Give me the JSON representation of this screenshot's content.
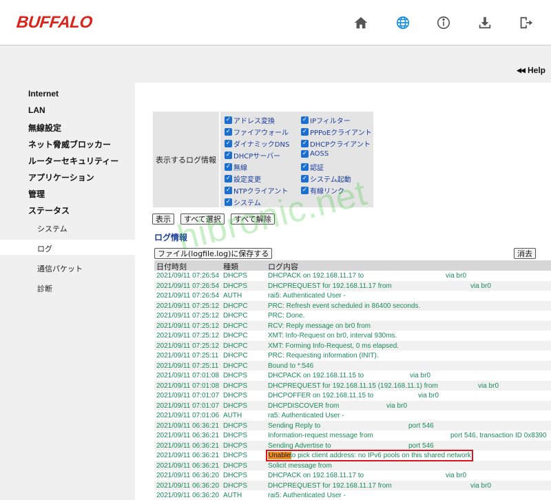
{
  "brand": {
    "logo": "BUFFALO",
    "color": "#d9241b"
  },
  "header_icons": [
    {
      "name": "home-icon"
    },
    {
      "name": "globe-icon",
      "active": true
    },
    {
      "name": "info-icon"
    },
    {
      "name": "download-icon"
    },
    {
      "name": "logout-icon"
    }
  ],
  "help": {
    "label": "Help"
  },
  "sidebar": {
    "main_items": [
      "Internet",
      "LAN",
      "無線設定",
      "ネット脅威ブロッカー",
      "ルーターセキュリティー",
      "アプリケーション",
      "管理",
      "ステータス"
    ],
    "sub_items": [
      "システム",
      "ログ",
      "通信パケット",
      "診断"
    ],
    "active": "ログ"
  },
  "filter": {
    "label": "表示するログ情報",
    "options_left": [
      "アドレス変換",
      "ファイアウォール",
      "ダイナミックDNS",
      "DHCPサーバー",
      "無線",
      "設定変更",
      "NTPクライアント",
      "システム"
    ],
    "options_right": [
      "IPフィルター",
      "PPPoEクライアント",
      "DHCPクライアント",
      "AOSS",
      "認証",
      "システム起動",
      "有線リンク"
    ]
  },
  "buttons": {
    "show": "表示",
    "select_all": "すべて選択",
    "clear_all": "すべて解除",
    "save_file": "ファイル(logfile.log)に保存する",
    "delete": "消去"
  },
  "log_section_title": "ログ情報",
  "log_columns": [
    "日付時刻",
    "種類",
    "ログ内容"
  ],
  "log_rows": [
    {
      "date": "2021/09/11 07:26:54",
      "type": "DHCPS",
      "msg": "DHCPACK on 192.168.11.17 to",
      "extra": "via br0"
    },
    {
      "date": "2021/09/11 07:26:54",
      "type": "DHCPS",
      "msg": "DHCPREQUEST for 192.168.11.17 from",
      "extra": "via br0"
    },
    {
      "date": "2021/09/11 07:26:54",
      "type": "AUTH",
      "msg": "rai5: Authenticated User -",
      "extra": ""
    },
    {
      "date": "2021/09/11 07:25:12",
      "type": "DHCPC",
      "msg": "PRC: Refresh event scheduled in 86400 seconds.",
      "extra": ""
    },
    {
      "date": "2021/09/11 07:25:12",
      "type": "DHCPC",
      "msg": "PRC: Done.",
      "extra": ""
    },
    {
      "date": "2021/09/11 07:25:12",
      "type": "DHCPC",
      "msg": "RCV: Reply message on br0 from",
      "extra": ""
    },
    {
      "date": "2021/09/11 07:25:12",
      "type": "DHCPC",
      "msg": "XMT: Info-Request on br0, interval 930ms.",
      "extra": ""
    },
    {
      "date": "2021/09/11 07:25:12",
      "type": "DHCPC",
      "msg": "XMT: Forming Info-Request, 0 ms elapsed.",
      "extra": ""
    },
    {
      "date": "2021/09/11 07:25:11",
      "type": "DHCPC",
      "msg": "PRC: Requesting information (INIT).",
      "extra": ""
    },
    {
      "date": "2021/09/11 07:25:11",
      "type": "DHCPC",
      "msg": "Bound to *:546",
      "extra": ""
    },
    {
      "date": "2021/09/11 07:01:08",
      "type": "DHCPS",
      "msg": "DHCPACK on 192.168.11.15 to",
      "extra": "via br0"
    },
    {
      "date": "2021/09/11 07:01:08",
      "type": "DHCPS",
      "msg": "DHCPREQUEST for 192.168.11.15 (192.168.11.1) from",
      "extra": "via br0"
    },
    {
      "date": "2021/09/11 07:01:07",
      "type": "DHCPS",
      "msg": "DHCPOFFER on 192.168.11.15 to",
      "extra": "via br0"
    },
    {
      "date": "2021/09/11 07:01:07",
      "type": "DHCPS",
      "msg": "DHCPDISCOVER from",
      "extra": "via br0"
    },
    {
      "date": "2021/09/11 07:01:06",
      "type": "AUTH",
      "msg": "ra5: Authenticated User -",
      "extra": ""
    },
    {
      "date": "2021/09/11 06:36:21",
      "type": "DHCPS",
      "msg": "Sending Reply to",
      "extra": "port 546"
    },
    {
      "date": "2021/09/11 06:36:21",
      "type": "DHCPS",
      "msg": "Information-request message from",
      "extra": "port 546, transaction ID 0x8390"
    },
    {
      "date": "2021/09/11 06:36:21",
      "type": "DHCPS",
      "msg": "Sending Advertise to",
      "extra": "port 546"
    },
    {
      "date": "2021/09/11 06:36:21",
      "type": "DHCPS",
      "msg_highlight": "Unable",
      "msg": " to pick client address: no IPv6 pools on this shared network",
      "extra": ""
    },
    {
      "date": "2021/09/11 06:36:21",
      "type": "DHCPS",
      "msg": "Solicit message from",
      "extra": ""
    },
    {
      "date": "2021/09/11 06:36:20",
      "type": "DHCPS",
      "msg": "DHCPACK on 192.168.11.17 to",
      "extra": "via br0"
    },
    {
      "date": "2021/09/11 06:36:20",
      "type": "DHCPS",
      "msg": "DHCPREQUEST for 192.168.11.17 from",
      "extra": "via br0"
    },
    {
      "date": "2021/09/11 06:36:20",
      "type": "AUTH",
      "msg": "rai5: Authenticated User -",
      "extra": ""
    }
  ],
  "watermark": "hibronic.net",
  "colors": {
    "log_text": "#1a8a5a",
    "highlight": "#f08c1e",
    "highlight_border": "#e0141b",
    "checkbox": "#1a6fd1",
    "title": "#1a3d99"
  }
}
